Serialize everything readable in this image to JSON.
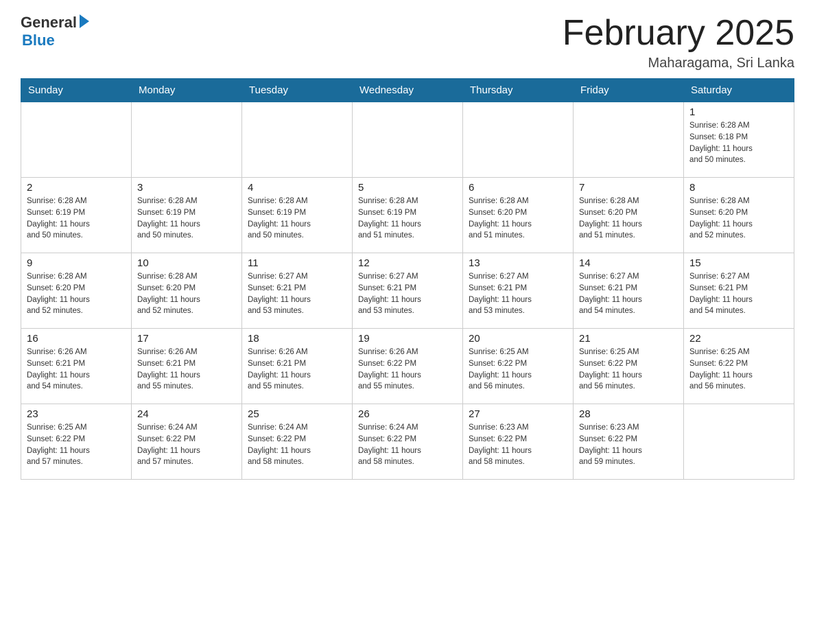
{
  "header": {
    "logo_general": "General",
    "logo_blue": "Blue",
    "month_title": "February 2025",
    "location": "Maharagama, Sri Lanka"
  },
  "days_of_week": [
    "Sunday",
    "Monday",
    "Tuesday",
    "Wednesday",
    "Thursday",
    "Friday",
    "Saturday"
  ],
  "weeks": [
    [
      {
        "day": "",
        "info": ""
      },
      {
        "day": "",
        "info": ""
      },
      {
        "day": "",
        "info": ""
      },
      {
        "day": "",
        "info": ""
      },
      {
        "day": "",
        "info": ""
      },
      {
        "day": "",
        "info": ""
      },
      {
        "day": "1",
        "info": "Sunrise: 6:28 AM\nSunset: 6:18 PM\nDaylight: 11 hours\nand 50 minutes."
      }
    ],
    [
      {
        "day": "2",
        "info": "Sunrise: 6:28 AM\nSunset: 6:19 PM\nDaylight: 11 hours\nand 50 minutes."
      },
      {
        "day": "3",
        "info": "Sunrise: 6:28 AM\nSunset: 6:19 PM\nDaylight: 11 hours\nand 50 minutes."
      },
      {
        "day": "4",
        "info": "Sunrise: 6:28 AM\nSunset: 6:19 PM\nDaylight: 11 hours\nand 50 minutes."
      },
      {
        "day": "5",
        "info": "Sunrise: 6:28 AM\nSunset: 6:19 PM\nDaylight: 11 hours\nand 51 minutes."
      },
      {
        "day": "6",
        "info": "Sunrise: 6:28 AM\nSunset: 6:20 PM\nDaylight: 11 hours\nand 51 minutes."
      },
      {
        "day": "7",
        "info": "Sunrise: 6:28 AM\nSunset: 6:20 PM\nDaylight: 11 hours\nand 51 minutes."
      },
      {
        "day": "8",
        "info": "Sunrise: 6:28 AM\nSunset: 6:20 PM\nDaylight: 11 hours\nand 52 minutes."
      }
    ],
    [
      {
        "day": "9",
        "info": "Sunrise: 6:28 AM\nSunset: 6:20 PM\nDaylight: 11 hours\nand 52 minutes."
      },
      {
        "day": "10",
        "info": "Sunrise: 6:28 AM\nSunset: 6:20 PM\nDaylight: 11 hours\nand 52 minutes."
      },
      {
        "day": "11",
        "info": "Sunrise: 6:27 AM\nSunset: 6:21 PM\nDaylight: 11 hours\nand 53 minutes."
      },
      {
        "day": "12",
        "info": "Sunrise: 6:27 AM\nSunset: 6:21 PM\nDaylight: 11 hours\nand 53 minutes."
      },
      {
        "day": "13",
        "info": "Sunrise: 6:27 AM\nSunset: 6:21 PM\nDaylight: 11 hours\nand 53 minutes."
      },
      {
        "day": "14",
        "info": "Sunrise: 6:27 AM\nSunset: 6:21 PM\nDaylight: 11 hours\nand 54 minutes."
      },
      {
        "day": "15",
        "info": "Sunrise: 6:27 AM\nSunset: 6:21 PM\nDaylight: 11 hours\nand 54 minutes."
      }
    ],
    [
      {
        "day": "16",
        "info": "Sunrise: 6:26 AM\nSunset: 6:21 PM\nDaylight: 11 hours\nand 54 minutes."
      },
      {
        "day": "17",
        "info": "Sunrise: 6:26 AM\nSunset: 6:21 PM\nDaylight: 11 hours\nand 55 minutes."
      },
      {
        "day": "18",
        "info": "Sunrise: 6:26 AM\nSunset: 6:21 PM\nDaylight: 11 hours\nand 55 minutes."
      },
      {
        "day": "19",
        "info": "Sunrise: 6:26 AM\nSunset: 6:22 PM\nDaylight: 11 hours\nand 55 minutes."
      },
      {
        "day": "20",
        "info": "Sunrise: 6:25 AM\nSunset: 6:22 PM\nDaylight: 11 hours\nand 56 minutes."
      },
      {
        "day": "21",
        "info": "Sunrise: 6:25 AM\nSunset: 6:22 PM\nDaylight: 11 hours\nand 56 minutes."
      },
      {
        "day": "22",
        "info": "Sunrise: 6:25 AM\nSunset: 6:22 PM\nDaylight: 11 hours\nand 56 minutes."
      }
    ],
    [
      {
        "day": "23",
        "info": "Sunrise: 6:25 AM\nSunset: 6:22 PM\nDaylight: 11 hours\nand 57 minutes."
      },
      {
        "day": "24",
        "info": "Sunrise: 6:24 AM\nSunset: 6:22 PM\nDaylight: 11 hours\nand 57 minutes."
      },
      {
        "day": "25",
        "info": "Sunrise: 6:24 AM\nSunset: 6:22 PM\nDaylight: 11 hours\nand 58 minutes."
      },
      {
        "day": "26",
        "info": "Sunrise: 6:24 AM\nSunset: 6:22 PM\nDaylight: 11 hours\nand 58 minutes."
      },
      {
        "day": "27",
        "info": "Sunrise: 6:23 AM\nSunset: 6:22 PM\nDaylight: 11 hours\nand 58 minutes."
      },
      {
        "day": "28",
        "info": "Sunrise: 6:23 AM\nSunset: 6:22 PM\nDaylight: 11 hours\nand 59 minutes."
      },
      {
        "day": "",
        "info": ""
      }
    ]
  ]
}
